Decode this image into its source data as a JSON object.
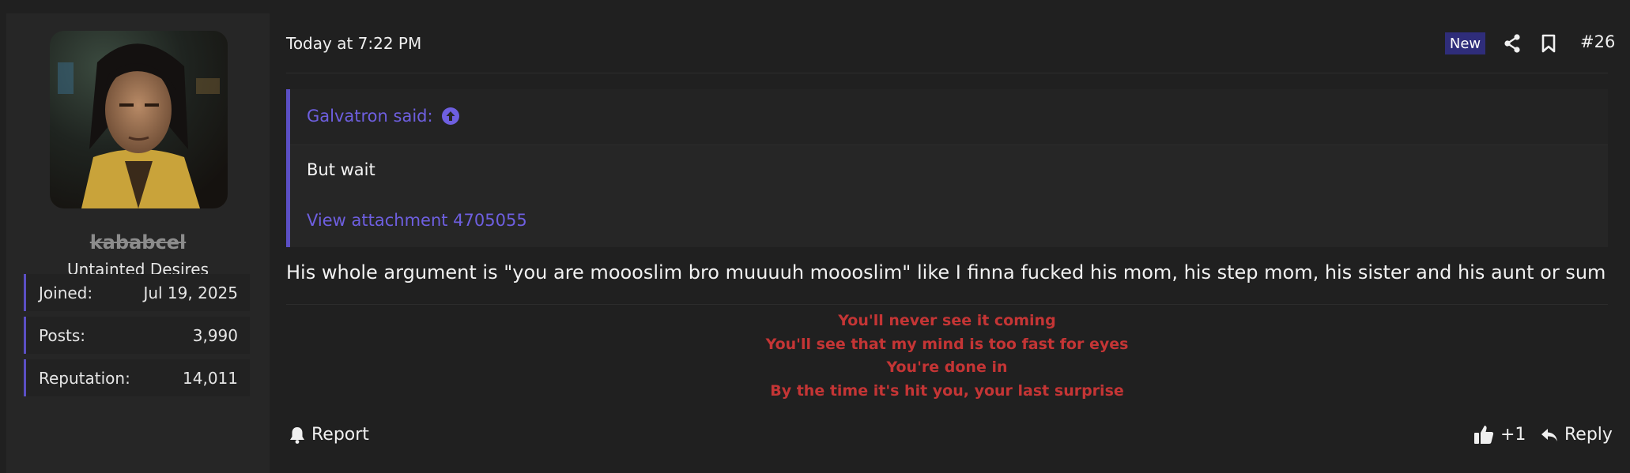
{
  "user": {
    "name": "kababcel",
    "title": "Untainted Desires",
    "stats": [
      {
        "label": "Joined:",
        "value": "Jul 19, 2025"
      },
      {
        "label": "Posts:",
        "value": "3,990"
      },
      {
        "label": "Reputation:",
        "value": "14,011"
      }
    ]
  },
  "post": {
    "date": "Today at 7:22 PM",
    "new_badge": "New",
    "number": "#26",
    "quote": {
      "author": "Galvatron said:",
      "text": "But wait",
      "attachment": "View attachment 4705055"
    },
    "body": "His whole argument is \"you are moooslim bro muuuuh moooslim\" like I finna fucked his mom, his step mom, his sister and his aunt or sum",
    "signature": [
      "You'll never see it coming",
      "You'll see that my mind is too fast for eyes",
      "You're done in",
      "By the time it's hit you, your last surprise"
    ]
  },
  "footer": {
    "report_label": "Report",
    "reaction_label": "+1",
    "reply_label": "Reply"
  },
  "colors": {
    "accent": "#5b4fc4",
    "link": "#6e5fe0",
    "signature": "#c43535",
    "badge": "#2f2d7a"
  },
  "icons": [
    "share-icon",
    "bookmark-icon",
    "arrow-up-circle-icon",
    "bell-icon",
    "thumbs-up-icon",
    "reply-icon"
  ]
}
